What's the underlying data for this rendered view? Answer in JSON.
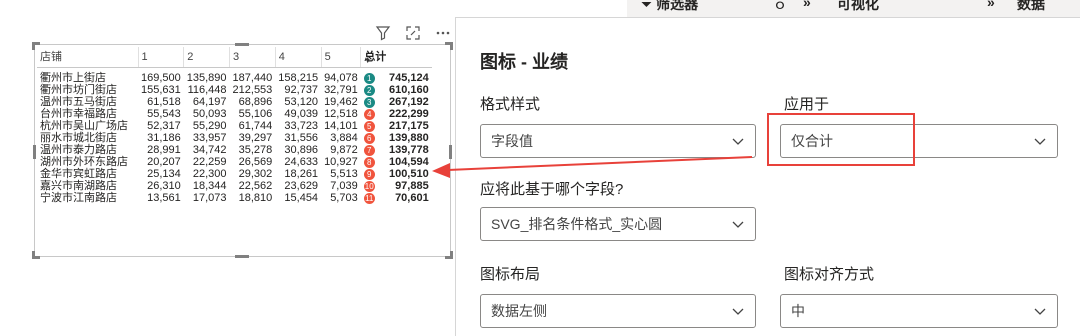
{
  "tabs": {
    "filter_label": "筛选器",
    "viz_label": "可视化",
    "data_label": "数据",
    "collapse_glyph": "»"
  },
  "table": {
    "headers": [
      "店铺",
      "1",
      "2",
      "3",
      "4",
      "5",
      "总计"
    ],
    "rows": [
      {
        "store": "衢州市上街店",
        "v1": "169,500",
        "v2": "135,890",
        "v3": "187,440",
        "v4": "158,215",
        "v5": "94,078",
        "rank": "1",
        "total": "745,124"
      },
      {
        "store": "衢州市坊门街店",
        "v1": "155,631",
        "v2": "116,448",
        "v3": "212,553",
        "v4": "92,737",
        "v5": "32,791",
        "rank": "2",
        "total": "610,160"
      },
      {
        "store": "温州市五马街店",
        "v1": "61,518",
        "v2": "64,197",
        "v3": "68,896",
        "v4": "53,120",
        "v5": "19,462",
        "rank": "3",
        "total": "267,192"
      },
      {
        "store": "台州市幸福路店",
        "v1": "55,543",
        "v2": "50,093",
        "v3": "55,106",
        "v4": "49,039",
        "v5": "12,518",
        "rank": "4",
        "total": "222,299"
      },
      {
        "store": "杭州市吴山广场店",
        "v1": "52,317",
        "v2": "55,290",
        "v3": "61,744",
        "v4": "33,723",
        "v5": "14,101",
        "rank": "5",
        "total": "217,175"
      },
      {
        "store": "丽水市城北街店",
        "v1": "31,186",
        "v2": "33,957",
        "v3": "39,297",
        "v4": "31,556",
        "v5": "3,884",
        "rank": "6",
        "total": "139,880"
      },
      {
        "store": "温州市泰力路店",
        "v1": "28,991",
        "v2": "34,742",
        "v3": "35,278",
        "v4": "30,896",
        "v5": "9,872",
        "rank": "7",
        "total": "139,778"
      },
      {
        "store": "湖州市外环东路店",
        "v1": "20,207",
        "v2": "22,259",
        "v3": "26,569",
        "v4": "24,633",
        "v5": "10,927",
        "rank": "8",
        "total": "104,594"
      },
      {
        "store": "金华市宾虹路店",
        "v1": "25,134",
        "v2": "22,300",
        "v3": "29,302",
        "v4": "18,261",
        "v5": "5,513",
        "rank": "9",
        "total": "100,510"
      },
      {
        "store": "嘉兴市南湖路店",
        "v1": "26,310",
        "v2": "18,344",
        "v3": "22,562",
        "v4": "23,629",
        "v5": "7,039",
        "rank": "10",
        "total": "97,885"
      },
      {
        "store": "宁波市江南路店",
        "v1": "13,561",
        "v2": "17,073",
        "v3": "18,810",
        "v4": "15,454",
        "v5": "5,703",
        "rank": "11",
        "total": "70,601"
      }
    ],
    "rank_colors": {
      "top": "#1a8a84",
      "rest": "#f0543d"
    }
  },
  "format_pane": {
    "title": "图标 - 业绩",
    "format_style_label": "格式样式",
    "format_style_value": "字段值",
    "apply_to_label": "应用于",
    "apply_to_value": "仅合计",
    "base_field_label": "应将此基于哪个字段?",
    "base_field_value": "SVG_排名条件格式_实心圆",
    "layout_label": "图标布局",
    "layout_value": "数据左侧",
    "align_label": "图标对齐方式",
    "align_value": "中"
  },
  "icons": [
    "filter-icon",
    "focus-mode-icon",
    "more-options-icon",
    "chevron-down-icon"
  ],
  "colors": {
    "highlight": "#e8413a",
    "arrow": "#e8413a"
  }
}
